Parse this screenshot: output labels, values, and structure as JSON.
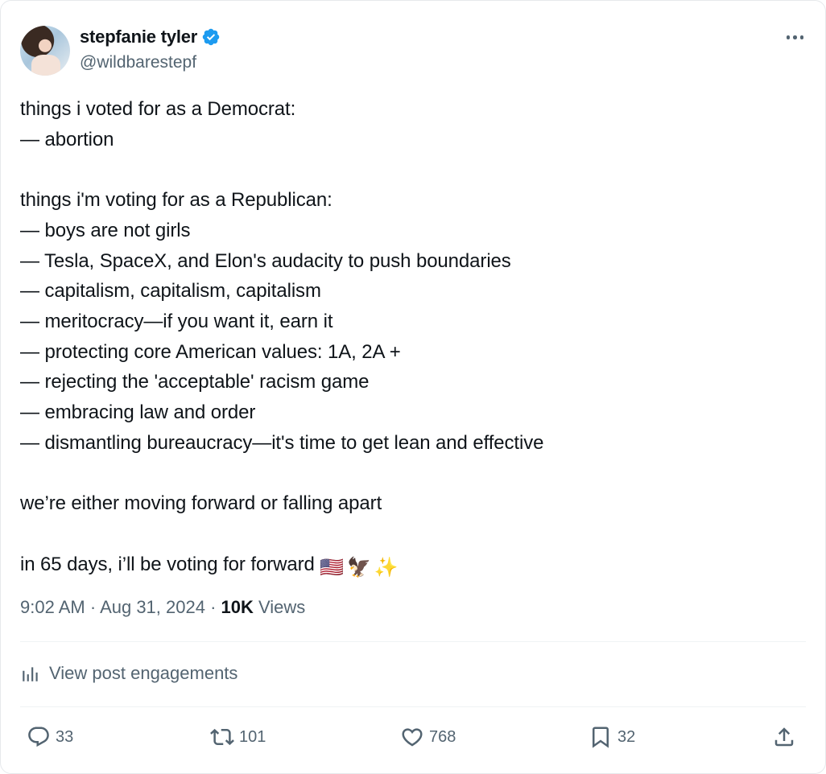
{
  "author": {
    "name": "stepfanie tyler",
    "handle": "@wildbarestepf"
  },
  "tweet": {
    "text": "things i voted for as a Democrat:\n— abortion\n\nthings i'm voting for as a Republican:\n— boys are not girls\n— Tesla, SpaceX, and Elon's audacity to push boundaries\n— capitalism, capitalism, capitalism\n— meritocracy—if you want it, earn it\n— protecting core American values: 1A, 2A +\n— rejecting the 'acceptable' racism game\n— embracing law and order\n— dismantling bureaucracy—it's time to get lean and effective\n\nwe’re either moving forward or falling apart\n\n",
    "last_line": "in 65 days, i’ll be voting for forward",
    "emojis": [
      "🇺🇸",
      "🦅",
      "✨"
    ]
  },
  "meta": {
    "time": "9:02 AM",
    "sep1": " · ",
    "date": "Aug 31, 2024",
    "sep2": " · ",
    "views_count": "10K",
    "views_label": " Views"
  },
  "engagements_label": "View post engagements",
  "actions": {
    "replies": "33",
    "reposts": "101",
    "likes": "768",
    "bookmarks": "32"
  },
  "colors": {
    "text": "#0f1419",
    "secondary": "#536471",
    "verified": "#1d9bf0",
    "divider": "#eff3f4"
  },
  "icons": [
    "verified-badge-icon",
    "more-icon",
    "analytics-icon",
    "reply-icon",
    "repost-icon",
    "like-icon",
    "bookmark-icon",
    "share-icon"
  ]
}
